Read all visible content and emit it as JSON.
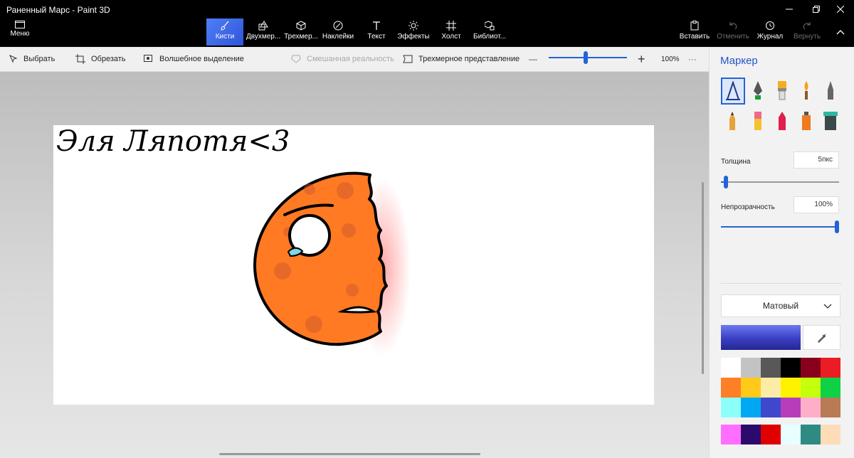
{
  "window": {
    "title": "Раненный Марс - Paint 3D"
  },
  "menu": {
    "label": "Меню"
  },
  "tools": [
    {
      "label": "Кисти",
      "icon": "brush-icon"
    },
    {
      "label": "Двухмер...",
      "icon": "2d-shapes-icon"
    },
    {
      "label": "Трехмер...",
      "icon": "3d-shapes-icon"
    },
    {
      "label": "Наклейки",
      "icon": "stickers-icon"
    },
    {
      "label": "Текст",
      "icon": "text-icon"
    },
    {
      "label": "Эффекты",
      "icon": "effects-icon"
    },
    {
      "label": "Холст",
      "icon": "canvas-icon"
    },
    {
      "label": "Библиот...",
      "icon": "3d-library-icon"
    }
  ],
  "right_tools": {
    "paste": "Вставить",
    "undo": "Отменить",
    "history": "Журнал",
    "redo": "Вернуть"
  },
  "commandbar": {
    "select": "Выбрать",
    "crop": "Обрезать",
    "magic_select": "Волшебное выделение",
    "mixed_reality": "Смешанная реальность",
    "view_3d": "Трехмерное представление",
    "zoom_minus": "—",
    "zoom_plus": "+",
    "zoom_value": "100%",
    "zoom_fraction": 0.47,
    "more": "···"
  },
  "canvas": {
    "handwriting": "Эля Ляпотя<3"
  },
  "panel": {
    "title": "Маркер",
    "thickness_label": "Толщина",
    "thickness_value": "5пкс",
    "thickness_fraction": 0.04,
    "opacity_label": "Непрозрачность",
    "opacity_value": "100%",
    "opacity_fraction": 1.0,
    "finish": "Матовый",
    "current_color": "#3b3fc4",
    "palette": [
      "#ffffff",
      "#c3c3c3",
      "#585858",
      "#000000",
      "#88001b",
      "#ec1c24",
      "#ff7f27",
      "#ffca18",
      "#fdeca6",
      "#fff200",
      "#c4ff0e",
      "#0ed145",
      "#8cfffb",
      "#00a8f3",
      "#3f48cc",
      "#b83dba",
      "#ffaec8",
      "#b97a56"
    ],
    "custom_palette": [
      "#ff6eff",
      "#2b0a6b",
      "#e00000",
      "#e8ffff",
      "#2e8b82",
      "#ffdcb8"
    ]
  }
}
